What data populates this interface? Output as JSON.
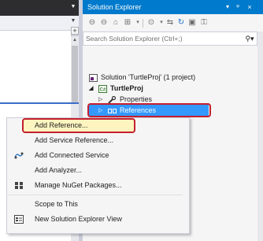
{
  "solution_explorer": {
    "title": "Solution Explorer",
    "search_placeholder": "Search Solution Explorer (Ctrl+;)",
    "tree": {
      "solution": "Solution 'TurtleProj' (1 project)",
      "project": "TurtleProj",
      "properties": "Properties",
      "references": "References"
    }
  },
  "context_menu": {
    "items": [
      {
        "label": "Add Reference...",
        "icon": ""
      },
      {
        "label": "Add Service Reference...",
        "icon": ""
      },
      {
        "label": "Add Connected Service",
        "icon": "connected-service-icon"
      },
      {
        "label": "Add Analyzer...",
        "icon": ""
      },
      {
        "label": "Manage NuGet Packages...",
        "icon": "nuget-icon"
      },
      {
        "label": "Scope to This",
        "icon": ""
      },
      {
        "label": "New Solution Explorer View",
        "icon": "new-view-icon"
      }
    ]
  },
  "colors": {
    "accent_blue": "#007acc",
    "selection_blue": "#3399ff",
    "highlight_red": "#c4202e",
    "menu_hover": "#fdf4bf"
  }
}
